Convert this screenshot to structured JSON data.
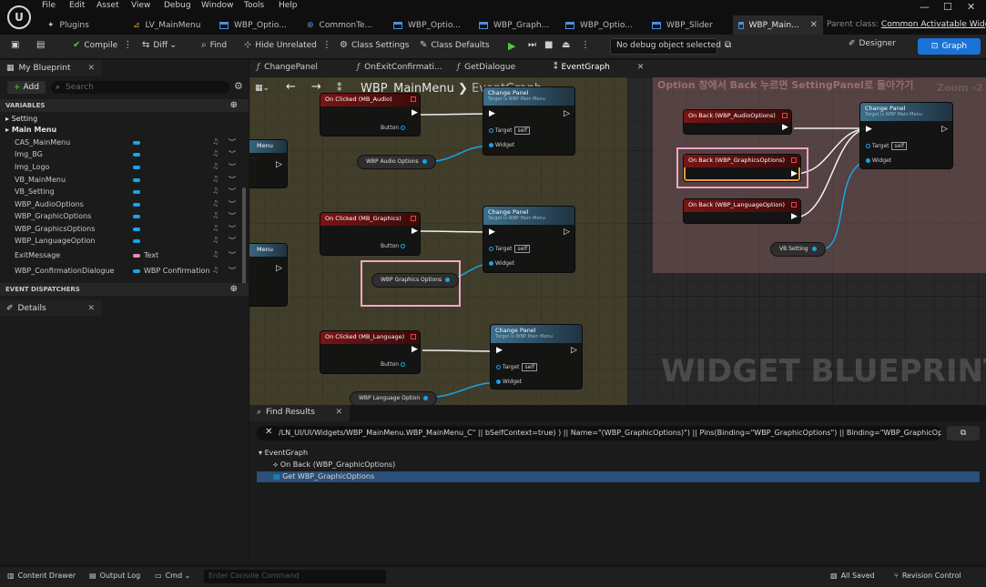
{
  "menu": [
    "File",
    "Edit",
    "Asset",
    "View",
    "Debug",
    "Window",
    "Tools",
    "Help"
  ],
  "doc_tabs": [
    {
      "label": "Plugins"
    },
    {
      "label": "LV_MainMenu"
    },
    {
      "label": "WBP_Optio..."
    },
    {
      "label": "CommonTe..."
    },
    {
      "label": "WBP_Optio..."
    },
    {
      "label": "WBP_Graph..."
    },
    {
      "label": "WBP_Optio..."
    },
    {
      "label": "WBP_Slider"
    },
    {
      "label": "WBP_Main..."
    }
  ],
  "parent_class": {
    "label": "Parent class:",
    "value": "Common Activatable Widget"
  },
  "toolbar": {
    "compile": "Compile",
    "diff": "Diff",
    "find": "Find",
    "hide_unrelated": "Hide Unrelated",
    "class_settings": "Class Settings",
    "class_defaults": "Class Defaults",
    "debug_select": "No debug object selected",
    "designer": "Designer",
    "graph": "Graph"
  },
  "my_blueprint": {
    "tab": "My Blueprint",
    "add": "Add",
    "search_placeholder": "Search",
    "variables_header": "VARIABLES",
    "categories": [
      "Setting",
      "Main Menu"
    ],
    "variables": [
      {
        "name": "CAS_MainMenu",
        "type": ""
      },
      {
        "name": "Img_BG",
        "type": ""
      },
      {
        "name": "Img_Logo",
        "type": ""
      },
      {
        "name": "VB_MainMenu",
        "type": ""
      },
      {
        "name": "VB_Setting",
        "type": ""
      },
      {
        "name": "WBP_AudioOptions",
        "type": ""
      },
      {
        "name": "WBP_GraphicOptions",
        "type": ""
      },
      {
        "name": "WBP_GraphicsOptions",
        "type": ""
      },
      {
        "name": "WBP_LanguageOption",
        "type": ""
      },
      {
        "name": "ExitMessage",
        "type": "Text"
      },
      {
        "name": "WBP_ConfirmationDialogue",
        "type": "WBP Confirmation"
      }
    ],
    "event_dispatchers_header": "EVENT DISPATCHERS"
  },
  "details_tab": "Details",
  "graph_tabs": [
    {
      "label": "ChangePanel"
    },
    {
      "label": "OnExitConfirmati..."
    },
    {
      "label": "GetDialogue"
    },
    {
      "label": "EventGraph"
    }
  ],
  "graph": {
    "breadcrumb_root": "WBP_MainMenu",
    "breadcrumb_sub": "EventGraph",
    "comment_title": "Option 창에서 Back 누르면 SettingPanel로 돌아가기",
    "zoom": "Zoom -2",
    "watermark": "WIDGET BLUEPRINT",
    "nodes": {
      "clicked_audio": "On Clicked (MB_Audio)",
      "clicked_graphics": "On Clicked (MB_Graphics)",
      "clicked_language": "On Clicked (MB_Language)",
      "button": "Button",
      "change_panel": "Change Panel",
      "target_is": "Target is WBP Main Menu",
      "target": "Target",
      "self": "self",
      "widget": "Widget",
      "get_audio": "WBP Audio Options",
      "get_graphics": "WBP Graphics Options",
      "get_language": "WBP Language Option",
      "back_audio": "On Back (WBP_AudioOptions)",
      "back_graphics": "On Back (WBP_GraphicsOptions)",
      "back_language": "On Back (WBP_LanguageOption)",
      "vb_setting": "VB Setting",
      "left_partial": "Menu"
    }
  },
  "find": {
    "tab": "Find Results",
    "query": "/LN_UI/UI/Widgets/WBP_MainMenu.WBP_MainMenu_C\" || bSelfContext=true) ) || Name=\"(WBP_GraphicOptions)\") || Pins(Binding=\"WBP_GraphicOptions\") || Binding=\"WBP_GraphicOptions\"",
    "results": [
      "EventGraph",
      "On Back (WBP_GraphicOptions)",
      "Get WBP_GraphicOptions"
    ]
  },
  "status": {
    "content_drawer": "Content Drawer",
    "output_log": "Output Log",
    "cmd": "Cmd",
    "console_placeholder": "Enter Console Command",
    "all_saved": "All Saved",
    "revision_control": "Revision Control"
  },
  "colors": {
    "accent": "#1a72d6",
    "pin": "#1aa4e8",
    "event_header": "#7a1414",
    "highlight": "#f2a6c6"
  }
}
